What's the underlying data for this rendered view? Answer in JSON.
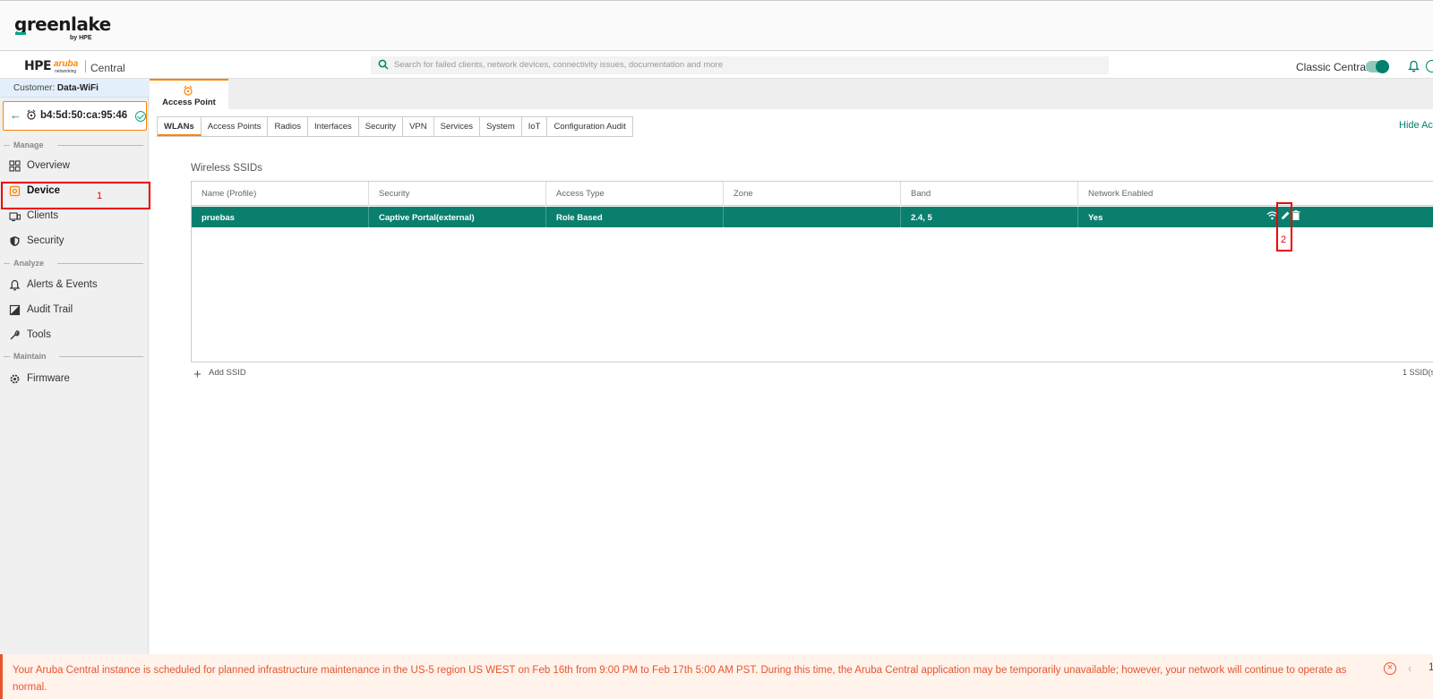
{
  "top": {
    "logo_text": "greenlake",
    "logo_by": "by HPE"
  },
  "header": {
    "hpe": "HPE",
    "aruba": "aruba",
    "aruba_sub": "networking",
    "app": "Central",
    "search_placeholder": "Search for failed clients, network devices, connectivity issues, documentation and more",
    "classic_label": "Classic Central",
    "classic_on": true
  },
  "sidebar": {
    "customer_label": "Customer:",
    "customer_name": "Data-WiFi",
    "device_mac": "b4:5d:50:ca:95:46",
    "sections": {
      "manage": "Manage",
      "analyze": "Analyze",
      "maintain": "Maintain"
    },
    "items": [
      {
        "label": "Overview",
        "icon": "grid-icon"
      },
      {
        "label": "Device",
        "icon": "device-icon",
        "active": true
      },
      {
        "label": "Clients",
        "icon": "clients-icon"
      },
      {
        "label": "Security",
        "icon": "shield-icon"
      },
      {
        "label": "Alerts & Events",
        "icon": "bell-icon"
      },
      {
        "label": "Audit Trail",
        "icon": "audit-icon"
      },
      {
        "label": "Tools",
        "icon": "wrench-icon"
      },
      {
        "label": "Firmware",
        "icon": "gear-icon"
      }
    ]
  },
  "annotations": {
    "one": "1",
    "two": "2"
  },
  "main": {
    "ap_tab": "Access Point",
    "subtabs": [
      "WLANs",
      "Access Points",
      "Radios",
      "Interfaces",
      "Security",
      "VPN",
      "Services",
      "System",
      "IoT",
      "Configuration Audit"
    ],
    "hide_link": "Hide Ac",
    "section_title": "Wireless SSIDs",
    "columns": [
      "Name (Profile)",
      "Security",
      "Access Type",
      "Zone",
      "Band",
      "Network Enabled"
    ],
    "rows": [
      [
        "pruebas",
        "Captive Portal(external)",
        "Role Based",
        "",
        "2.4, 5",
        "Yes"
      ]
    ],
    "add_ssid": "Add SSID",
    "ssid_count": "1 SSID(s"
  },
  "banner": {
    "text": "Your Aruba Central instance is scheduled for planned infrastructure maintenance in the US-5 region US WEST on Feb 16th from 9:00 PM to Feb 17th 5:00 AM PST. During this time, the Aruba Central application may be temporarily unavailable; however, your network will continue to operate as normal.",
    "page": "1"
  },
  "colors": {
    "accent_green": "#0a7f6e",
    "accent_orange": "#ff8300",
    "alert_red": "#e8552d"
  }
}
